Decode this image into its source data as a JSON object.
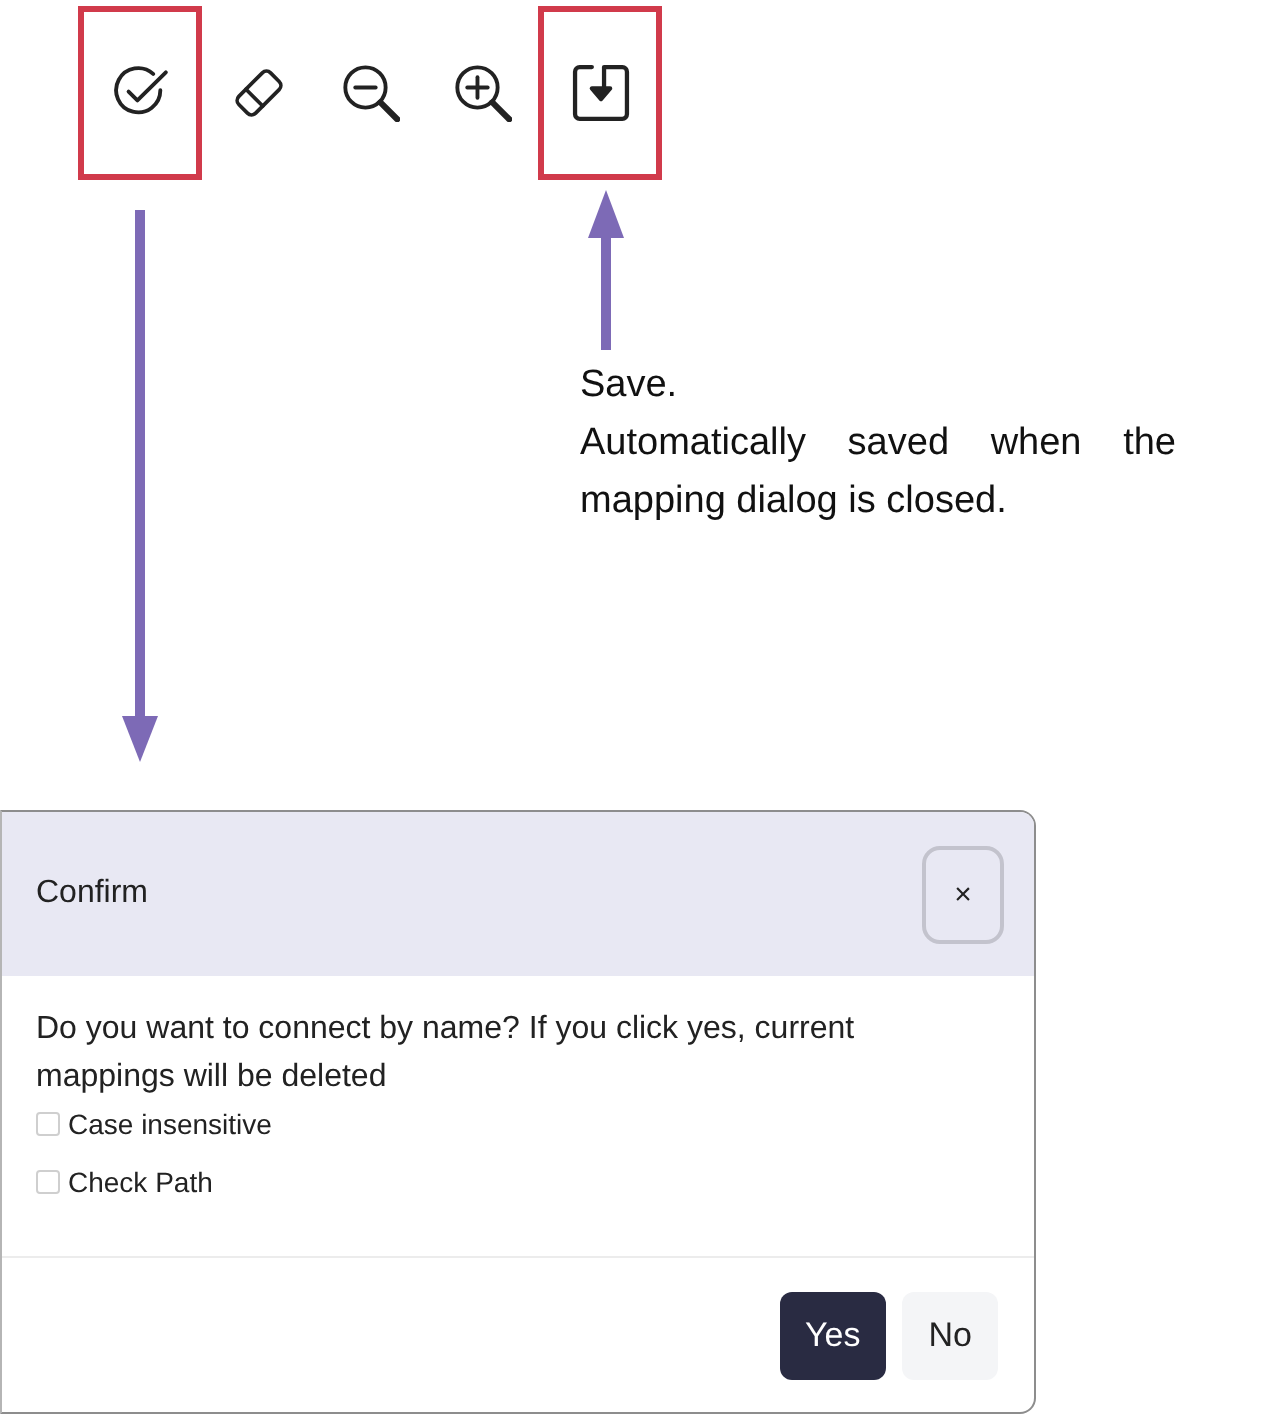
{
  "toolbar": {
    "items": [
      {
        "kind": "check",
        "highlighted": true
      },
      {
        "kind": "eraser",
        "highlighted": false
      },
      {
        "kind": "zoom-out",
        "highlighted": false
      },
      {
        "kind": "zoom-in",
        "highlighted": false
      },
      {
        "kind": "save",
        "highlighted": true
      }
    ]
  },
  "annotation": {
    "lines": [
      "Save.",
      "Automatically saved when the mapping dialog is closed."
    ]
  },
  "dialog": {
    "title": "Confirm",
    "close_label": "×",
    "message": "Do you want to connect by name? If you click yes, current mappings will be deleted",
    "options": [
      {
        "label": "Case insensitive",
        "checked": false
      },
      {
        "label": "Check Path",
        "checked": false
      }
    ],
    "buttons": [
      {
        "label": "Yes",
        "kind": "primary"
      },
      {
        "label": "No",
        "kind": "secondary"
      }
    ]
  }
}
